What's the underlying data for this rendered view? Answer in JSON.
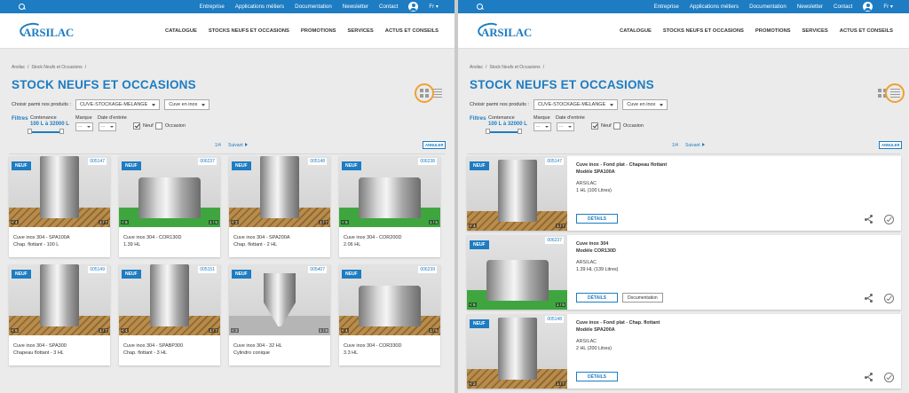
{
  "topbar": {
    "links": [
      "Entreprise",
      "Applications métiers",
      "Documentation",
      "Newsletter",
      "Contact"
    ],
    "lang": "Fr ▾"
  },
  "logo": {
    "text": "ARSILAC"
  },
  "nav": [
    "CATALOGUE",
    "STOCKS NEUFS ET OCCASIONS",
    "PROMOTIONS",
    "SERVICES",
    "ACTUS ET CONSEILS"
  ],
  "breadcrumb": [
    "Arsilac",
    "/",
    "Stock Neufs et Occasions",
    "/"
  ],
  "title": "STOCK NEUFS ET OCCASIONS",
  "chooser": {
    "label": "Choisir parmi nos produits :",
    "category": "CUVE-STOCKAGE-MELANGE",
    "subcategory": "Cuve en inox"
  },
  "filters": {
    "title": "Filtres",
    "capacity_label": "Contenance",
    "capacity_value": "100 L à 32000 L",
    "brand_label": "Marque",
    "date_label": "Date d'entrée",
    "brand_value": "...",
    "date_value": "...",
    "neuf_label": "Neuf",
    "neuf_checked": true,
    "occasion_label": "Occasion",
    "occasion_checked": false
  },
  "pager": {
    "page": "1/4",
    "next": "Suivant",
    "cancel": "ANNULER"
  },
  "badge_new": "NEUF",
  "colors": {
    "brand_blue": "#1d7cc2",
    "highlight_ring": "#f0a030"
  },
  "icons": {
    "grid": "grid-view-icon",
    "list": "list-view-icon",
    "share": "share-icon",
    "check": "check-circle-icon",
    "camera": "camera-icon"
  },
  "grid_items": [
    {
      "ref": "005147",
      "line1": "Cuve inox 304 - SPA100A",
      "line2": "Chap. flottant - 100 L",
      "count": "< 4",
      "photos": "1 / 7",
      "shape": "tall",
      "floor": "crate"
    },
    {
      "ref": "006237",
      "line1": "Cuve inox 304 - COR130D",
      "line2": "1.39 HL",
      "count": "< 5",
      "photos": "1 / 5",
      "shape": "wide",
      "floor": "green"
    },
    {
      "ref": "005148",
      "line1": "Cuve inox 304 - SPA200A",
      "line2": "Chap. flottant - 2 HL",
      "count": "< 2",
      "photos": "1 / 7",
      "shape": "tall",
      "floor": "crate"
    },
    {
      "ref": "006238",
      "line1": "Cuve inox 304 - COR200D",
      "line2": "2.06 HL",
      "count": "< 6",
      "photos": "1 / 5",
      "shape": "wide",
      "floor": "green"
    },
    {
      "ref": "005149",
      "line1": "Cuve inox 304 - SPA300",
      "line2": "Chapeau flottant - 3 HL",
      "count": "< 6",
      "photos": "1 / 7",
      "shape": "tall",
      "floor": "crate"
    },
    {
      "ref": "005151",
      "line1": "Cuve inox 304 - SPABP300",
      "line2": "Chap. flottant - 3 HL",
      "count": "< 4",
      "photos": "1 / 7",
      "shape": "tall",
      "floor": "crate"
    },
    {
      "ref": "005407",
      "line1": "Cuve inox 304 - 32 HL",
      "line2": "Cylindro conique",
      "count": "< 2",
      "photos": "1 / 8",
      "shape": "cone",
      "floor": "grey"
    },
    {
      "ref": "006239",
      "line1": "Cuve inox 304 - COR330D",
      "line2": "3.3 HL",
      "count": "< 4",
      "photos": "1 / 5",
      "shape": "wide",
      "floor": "crate"
    }
  ],
  "list_items": [
    {
      "ref": "005147",
      "line1": "Cuve inox - Fond plat - Chapeau flottant",
      "line2": "Modèle SPA100A",
      "brand": "ARSILAC",
      "cap": "1 HL (100 Litres)",
      "count": "< 4",
      "photos": "1 / 7",
      "details": "DÉTAILS",
      "doc": "",
      "shape": "tall",
      "floor": "crate"
    },
    {
      "ref": "006237",
      "line1": "Cuve inox 304",
      "line2": "Modèle COR130D",
      "brand": "ARSILAC",
      "cap": "1.39 HL (139 Litres)",
      "count": "< 5",
      "photos": "1 / 5",
      "details": "DÉTAILS",
      "doc": "Documentation",
      "shape": "wide",
      "floor": "green"
    },
    {
      "ref": "005148",
      "line1": "Cuve inox - Fond plat - Chap. flottant",
      "line2": "Modèle SPA200A",
      "brand": "ARSILAC",
      "cap": "2 HL (200 Litres)",
      "count": "< 2",
      "photos": "1 / 7",
      "details": "DÉTAILS",
      "doc": "",
      "shape": "tall",
      "floor": "crate"
    }
  ]
}
